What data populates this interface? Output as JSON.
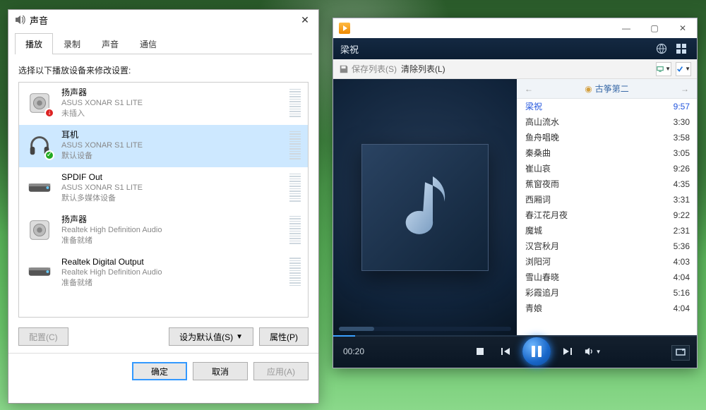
{
  "sound": {
    "title": "声音",
    "tabs": [
      "播放",
      "录制",
      "声音",
      "通信"
    ],
    "active_tab": 0,
    "helper": "选择以下播放设备来修改设置:",
    "devices": [
      {
        "name": "扬声器",
        "driver": "ASUS XONAR S1 LITE",
        "status": "未插入",
        "badge": "red",
        "icon": "speaker",
        "selected": false
      },
      {
        "name": "耳机",
        "driver": "ASUS XONAR S1 LITE",
        "status": "默认设备",
        "badge": "green",
        "icon": "headphone",
        "selected": true
      },
      {
        "name": "SPDIF Out",
        "driver": "ASUS XONAR S1 LITE",
        "status": "默认多媒体设备",
        "badge": "",
        "icon": "spdif",
        "selected": false
      },
      {
        "name": "扬声器",
        "driver": "Realtek High Definition Audio",
        "status": "准备就绪",
        "badge": "",
        "icon": "speaker",
        "selected": false
      },
      {
        "name": "Realtek Digital Output",
        "driver": "Realtek High Definition Audio",
        "status": "准备就绪",
        "badge": "",
        "icon": "spdif",
        "selected": false
      }
    ],
    "configure": "配置(C)",
    "set_default": "设为默认值(S)",
    "properties": "属性(P)",
    "ok": "确定",
    "cancel": "取消",
    "apply": "应用(A)"
  },
  "player": {
    "now_playing": "梁祝",
    "save_list": "保存列表(S)",
    "clear_list": "清除列表(L)",
    "playlist_title": "古筝第二",
    "elapsed": "00:20",
    "tracks": [
      {
        "name": "梁祝",
        "time": "9:57",
        "playing": true
      },
      {
        "name": "高山流水",
        "time": "3:30"
      },
      {
        "name": "鱼舟唱晚",
        "time": "3:58"
      },
      {
        "name": "秦桑曲",
        "time": "3:05"
      },
      {
        "name": "崔山哀",
        "time": "9:26"
      },
      {
        "name": "蕉窗夜雨",
        "time": "4:35"
      },
      {
        "name": "西厢词",
        "time": "3:31"
      },
      {
        "name": "春江花月夜",
        "time": "9:22"
      },
      {
        "name": "魔城",
        "time": "2:31"
      },
      {
        "name": "汉宫秋月",
        "time": "5:36"
      },
      {
        "name": "浏阳河",
        "time": "4:03"
      },
      {
        "name": "雪山春晓",
        "time": "4:04"
      },
      {
        "name": "彩霞追月",
        "time": "5:16"
      },
      {
        "name": "青娘",
        "time": "4:04"
      }
    ]
  }
}
